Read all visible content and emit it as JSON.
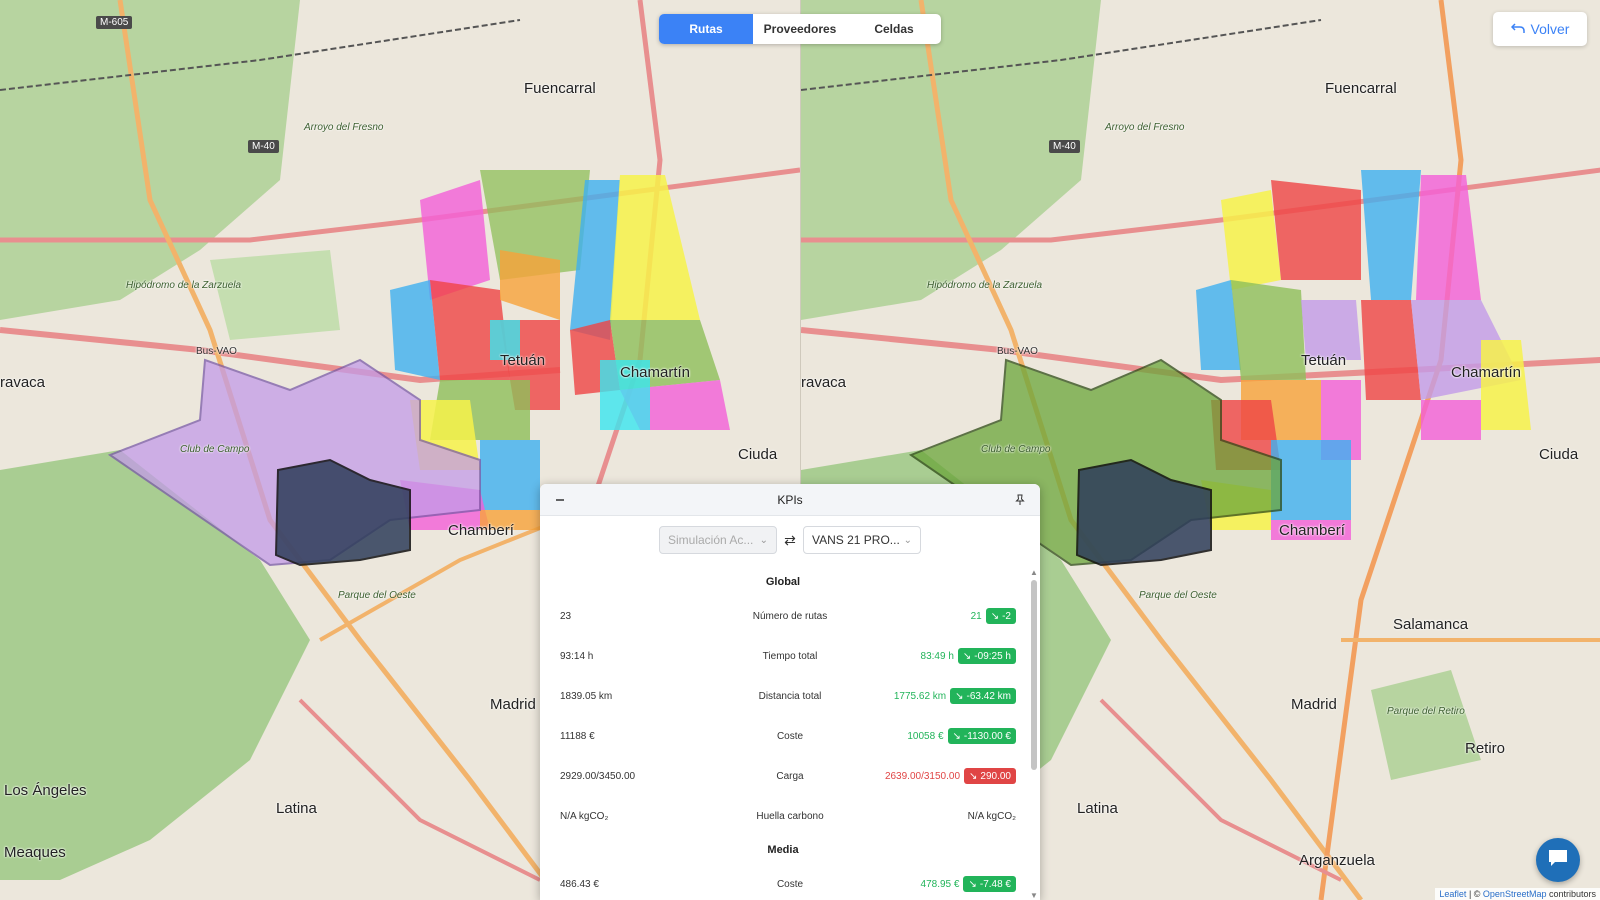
{
  "tabs": [
    {
      "label": "Rutas",
      "active": true
    },
    {
      "label": "Proveedores",
      "active": false
    },
    {
      "label": "Celdas",
      "active": false
    }
  ],
  "back_button": {
    "label": "Volver",
    "icon": "undo-icon"
  },
  "map_labels": {
    "fuencarral": "Fuencarral",
    "tetuan": "Tetuán",
    "chamartin": "Chamartín",
    "chamberi": "Chamberí",
    "madrid": "Madrid",
    "salamanca": "Salamanca",
    "retiro": "Retiro",
    "latina": "Latina",
    "arganzuela": "Arganzuela",
    "los_angeles": "Los Ángeles",
    "meaques": "Meaques",
    "aravaca": "ravaca",
    "ciuda": "Ciuda",
    "hipodromo": "Hipódromo de la Zarzuela",
    "club_campo": "Club de Campo",
    "arroyo": "Arroyo del Fresno",
    "parque_oeste": "Parque del Oeste",
    "parque_retiro": "Parque del Retiro",
    "m605": "M-605",
    "m40": "M-40",
    "bus_vao": "Bus-VAO"
  },
  "kpi_panel": {
    "title": "KPIs",
    "selector_left": "Simulación Ac...",
    "selector_right": "VANS 21 PRO...",
    "sections": [
      {
        "title": "Global",
        "rows": [
          {
            "base": "23",
            "label": "Número de rutas",
            "value": "21",
            "delta": "-2",
            "status": "good"
          },
          {
            "base": "93:14 h",
            "label": "Tiempo total",
            "value": "83:49 h",
            "delta": "-09:25 h",
            "status": "good"
          },
          {
            "base": "1839.05 km",
            "label": "Distancia total",
            "value": "1775.62 km",
            "delta": "-63.42 km",
            "status": "good"
          },
          {
            "base": "11188 €",
            "label": "Coste",
            "value": "10058 €",
            "delta": "-1130.00 €",
            "status": "good"
          },
          {
            "base": "2929.00/3450.00",
            "label": "Carga",
            "value": "2639.00/3150.00",
            "delta": "290.00",
            "status": "bad"
          },
          {
            "base": "N/A kgCO₂",
            "label": "Huella carbono",
            "value": "N/A kgCO₂",
            "delta": "",
            "status": "neutral"
          }
        ]
      },
      {
        "title": "Media",
        "rows": [
          {
            "base": "486.43 €",
            "label": "Coste",
            "value": "478.95 €",
            "delta": "-7.48 €",
            "status": "good"
          }
        ]
      }
    ]
  },
  "attribution": {
    "leaflet": "Leaflet",
    "sep": " | © ",
    "osm": "OpenStreetMap",
    "suffix": " contributors"
  },
  "colors": {
    "accent": "#3b82f6",
    "good": "#22b45a",
    "bad": "#e04545"
  }
}
